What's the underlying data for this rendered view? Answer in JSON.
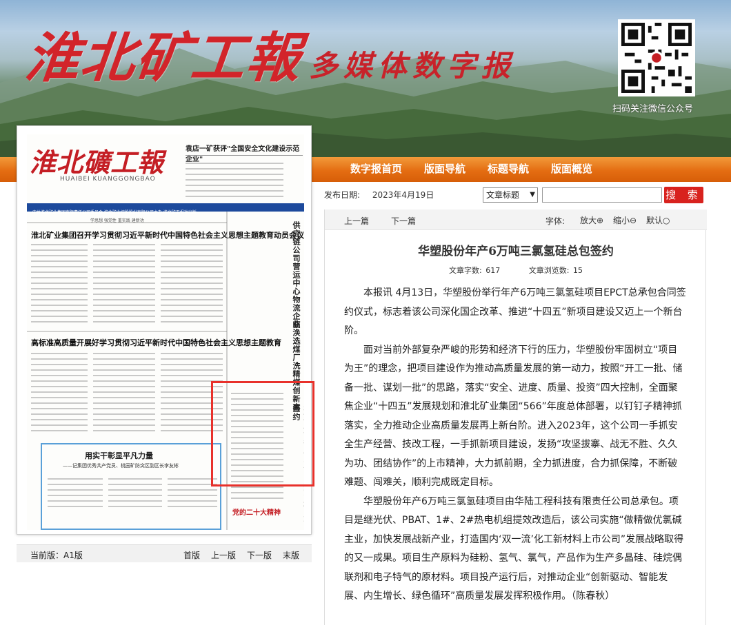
{
  "header": {
    "logo_main": "淮北矿工報",
    "logo_sub": "多媒体数字报",
    "qr_label": "扫码关注微信公众号"
  },
  "nav": {
    "items": [
      "数字报首页",
      "版面导航",
      "标题导航",
      "版面概览"
    ]
  },
  "paper_thumb": {
    "masthead": "淮北礦工報",
    "pinyin": "HUAIBEI  KUANGGONGBAO",
    "top_headline": "袁店一矿获评\"全国安全文化建设示范企业\"",
    "bar_text": "中共淮北矿业集团有限责任公司委员会   淮北矿业控股股份有限公司主办   淮北矿工报社出版",
    "slogan": "学思想 强党性 重实践 建新功",
    "headline_1": "淮北矿业集团召开学习贯彻习近平新时代中国特色社会主义思想主题教育动员会议",
    "headline_2": "高标准高质量开展好学习贯彻习近平新时代中国特色社会主义思想主题教育",
    "vertical_1": "供应链公司营运中心物流企业",
    "vertical_2": "临涣选煤厂洗精煤创新高",
    "vertical_3": "华塑股份年产6万吨三氯氢硅总包签约",
    "box_title": "用实干彰显平凡力量",
    "box_sub": "——记集团优秀共产党员、桃园矿防突区副区长李友彬",
    "stamp": "党的二十大精神"
  },
  "thumb_footer": {
    "current_edition": "当前版：A1版",
    "links": [
      "首版",
      "上一版",
      "下一版",
      "末版"
    ]
  },
  "search": {
    "date_label": "发布日期:",
    "date_value": "2023年4月19日",
    "select_value": "文章标题",
    "button_label": "搜 索"
  },
  "article": {
    "toolbar": {
      "prev": "上一篇",
      "next": "下一篇",
      "font_label": "字体:",
      "zoom_in": "放大",
      "zoom_out": "缩小",
      "default": "默认"
    },
    "title": "华塑股份年产6万吨三氯氢硅总包签约",
    "word_count": "文章字数: 617",
    "views": "文章浏览数: 15",
    "paragraphs": [
      "本报讯  4月13日，华塑股份举行年产6万吨三氯氢硅项目EPCT总承包合同签约仪式，标志着该公司深化国企改革、推进“十四五”新项目建设又迈上一个新台阶。",
      "面对当前外部复杂严峻的形势和经济下行的压力，华塑股份牢固树立“项目为王”的理念，把项目建设作为推动高质量发展的第一动力，按照“开工一批、储备一批、谋划一批”的思路，落实“安全、进度、质量、投资”四大控制，全面聚焦企业“十四五”发展规划和淮北矿业集团“566”年度总体部署，以钉钉子精神抓落实，全力推动企业高质量发展再上新台阶。进入2023年，这个公司一手抓安全生产经营、技改工程，一手抓新项目建设，发扬“攻坚拔寨、战无不胜、久久为功、团结协作”的上市精神，大力抓前期，全力抓进度，合力抓保障，不断破难题、闯难关，顺利完成既定目标。",
      "华塑股份年产6万吨三氯氢硅项目由华陆工程科技有限责任公司总承包。项目是继光伏、PBAT、1#、2#热电机组提效改造后，该公司实施“做精做优氯碱主业，加快发展战新产业，打造国内‘双一流’化工新材料上市公司”发展战略取得的又一成果。项目生产原料为硅粉、氢气、氯气，产品作为生产多晶硅、硅烷偶联剂和电子特气的原材料。项目投产运行后，对推动企业“创新驱动、智能发展、内生增长、绿色循环”高质量发展发挥积极作用。（陈春秋）"
    ]
  }
}
